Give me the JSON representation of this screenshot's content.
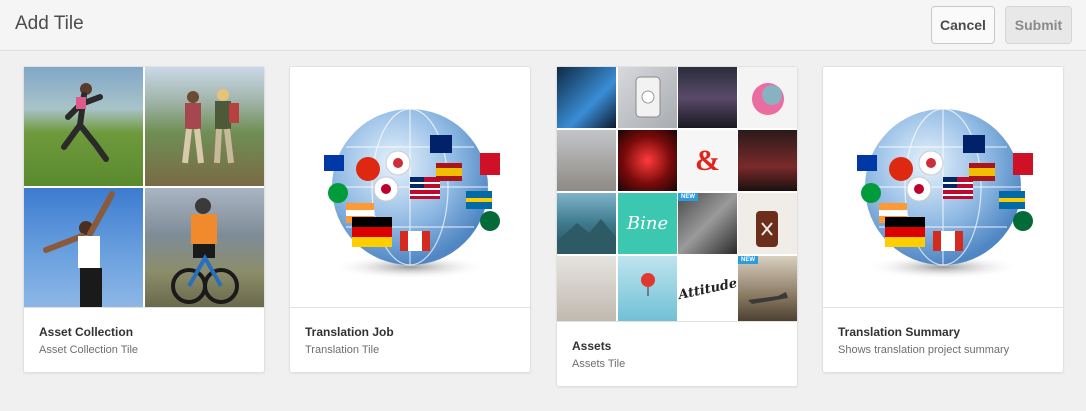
{
  "header": {
    "title": "Add Tile",
    "cancel_label": "Cancel",
    "submit_label": "Submit"
  },
  "tiles": [
    {
      "name": "Asset Collection",
      "description": "Asset Collection Tile"
    },
    {
      "name": "Translation Job",
      "description": "Translation Tile"
    },
    {
      "name": "Assets",
      "description": "Assets Tile"
    },
    {
      "name": "Translation Summary",
      "description": "Shows translation project summary"
    }
  ],
  "mosaic": {
    "adobe_logo": "&",
    "bine_label": "Bine",
    "attitude_label": "Attitude",
    "new_badge": "NEW"
  },
  "colors": {
    "header_bg": "#f5f5f5",
    "page_bg": "#f0f0f0",
    "card_bg": "#ffffff",
    "adobe_red": "#e1251b",
    "bine_teal": "#3cc7b0"
  }
}
